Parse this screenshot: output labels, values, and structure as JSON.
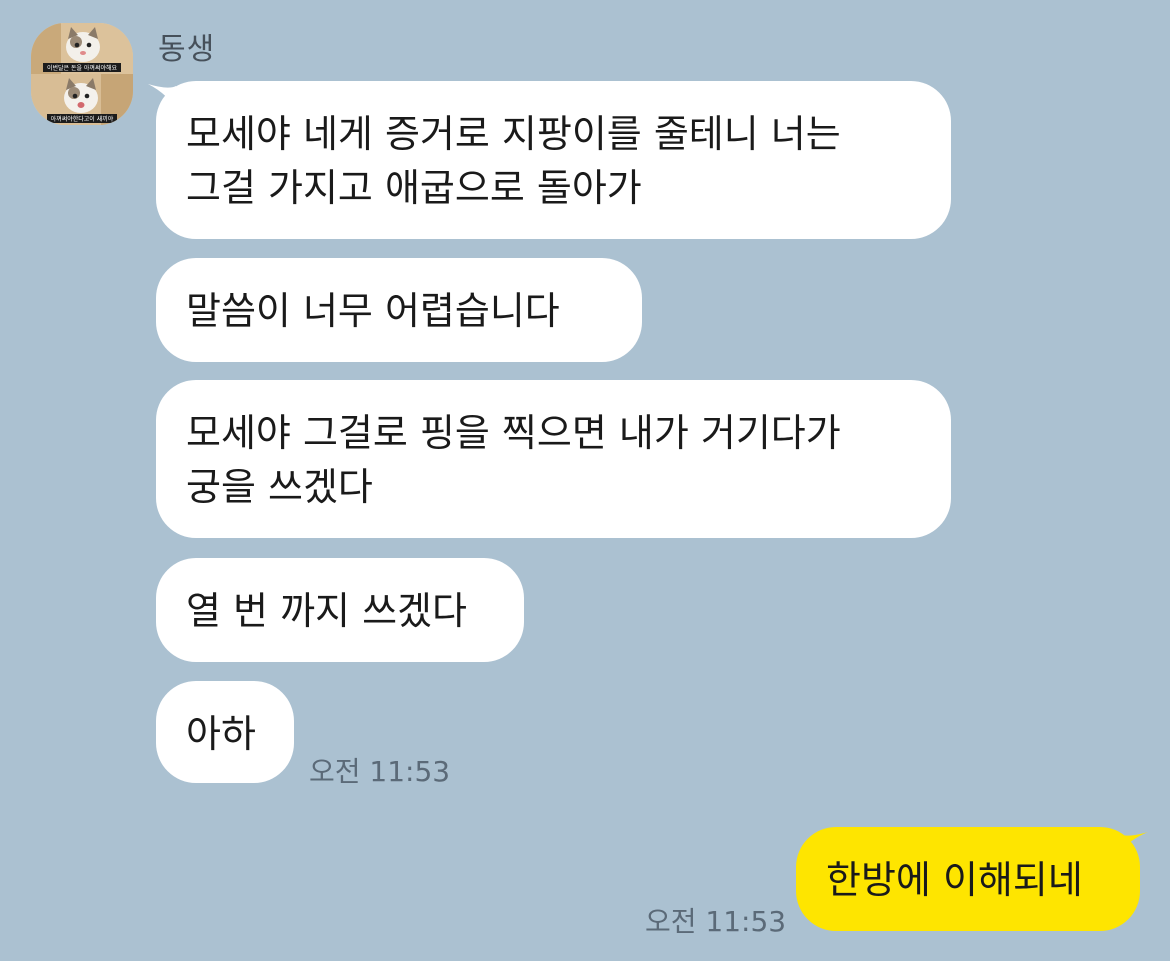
{
  "sender": {
    "name": "동생",
    "avatar_caption_top": "이번달은 돈을 아껴써야해요",
    "avatar_caption_bottom": "아껴써야한다고이 새끼야"
  },
  "messages": [
    {
      "lines": [
        "모세야 네게 증거로 지팡이를 줄테니 너는",
        "그걸 가지고 애굽으로 돌아가"
      ]
    },
    {
      "lines": [
        "말씀이 너무 어렵습니다"
      ]
    },
    {
      "lines": [
        "모세야 그걸로 핑을 찍으면 내가 거기다가",
        "궁을 쓰겠다"
      ]
    },
    {
      "lines": [
        "열 번 까지 쓰겠다"
      ]
    },
    {
      "lines": [
        "아하"
      ],
      "time": "오전 11:53"
    }
  ],
  "my_message": {
    "text": "한방에 이해되네",
    "time": "오전 11:53"
  },
  "colors": {
    "background": "#abc1d1",
    "incoming_bubble": "#ffffff",
    "outgoing_bubble": "#fee500"
  }
}
